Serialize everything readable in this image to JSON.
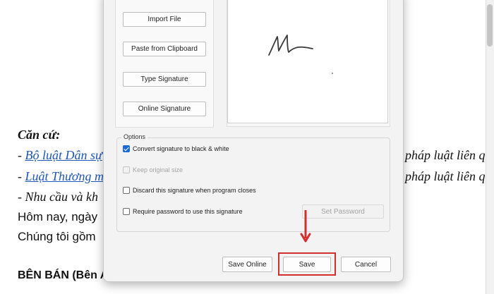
{
  "document": {
    "lines": [
      {
        "text": "Căn cứ:"
      },
      {
        "prefix": "- ",
        "link": "Bộ luật Dân sự",
        "tail": "pháp luật liên quan"
      },
      {
        "prefix": "- ",
        "link": "Luật Thương m",
        "tail": "pháp luật liên quan"
      },
      {
        "text": "- Nhu cầu và kh"
      },
      {
        "text": "Hôm nay, ngày"
      },
      {
        "text": "Chúng tôi gồm"
      },
      {
        "text": "BÊN BÁN (Bên A)"
      }
    ]
  },
  "dialog": {
    "buttons": {
      "import_file": "Import File",
      "paste_clipboard": "Paste from Clipboard",
      "type_signature": "Type Signature",
      "online_signature": "Online Signature"
    },
    "options": {
      "legend": "Options",
      "convert_bw": {
        "label": "Convert signature to black & white",
        "checked": true
      },
      "keep_original": {
        "label": "Keep original size",
        "checked": false,
        "disabled": true
      },
      "discard_on_close": {
        "label": "Discard this signature when program closes",
        "checked": false
      },
      "require_password": {
        "label": "Require password to use this signature",
        "checked": false
      },
      "set_password": "Set Password"
    },
    "footer": {
      "save_online": "Save Online",
      "save": "Save",
      "cancel": "Cancel"
    }
  },
  "colors": {
    "accent": "#1a6bd6",
    "highlight": "#d32f2f",
    "link": "#1f56b8"
  }
}
